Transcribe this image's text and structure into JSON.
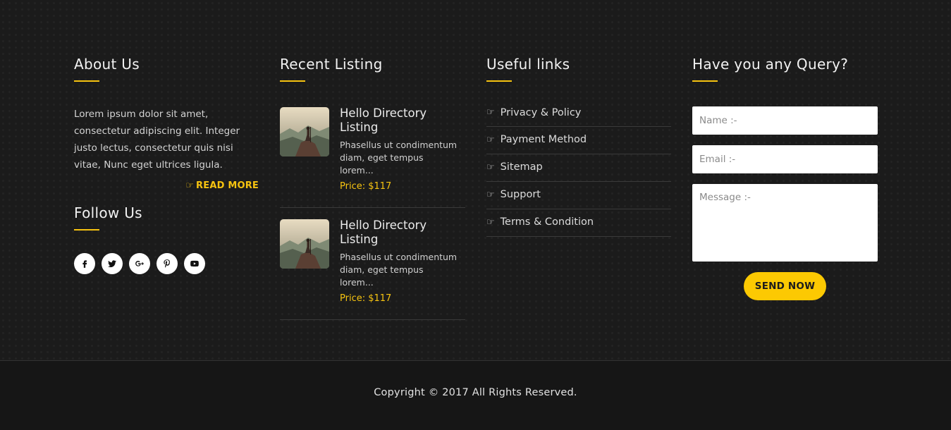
{
  "about": {
    "heading": "About Us",
    "text": "Lorem ipsum dolor sit amet, consectetur adipiscing elit. Integer justo lectus, consectetur quis nisi vitae, Nunc eget ultrices ligula.",
    "read_more": "READ MORE",
    "read_more_icon": "☞"
  },
  "follow": {
    "heading": "Follow Us",
    "icons": [
      "facebook-icon",
      "twitter-icon",
      "google-plus-icon",
      "pinterest-icon",
      "youtube-icon"
    ]
  },
  "recent": {
    "heading": "Recent Listing",
    "items": [
      {
        "title": "Hello Directory Listing",
        "desc": "Phasellus ut condimentum diam, eget tempus lorem...",
        "price": "Price: $117"
      },
      {
        "title": "Hello Directory Listing",
        "desc": "Phasellus ut condimentum diam, eget tempus lorem...",
        "price": "Price: $117"
      }
    ]
  },
  "links": {
    "heading": "Useful links",
    "icon": "☞",
    "items": [
      "Privacy & Policy",
      "Payment Method",
      "Sitemap",
      "Support",
      "Terms & Condition"
    ]
  },
  "query": {
    "heading": "Have you any Query?",
    "name_placeholder": "Name :-",
    "email_placeholder": "Email :-",
    "message_placeholder": "Message :-",
    "send_label": "SEND NOW"
  },
  "copyright": "Copyright © 2017 All Rights Reserved.",
  "colors": {
    "accent": "#f6c310",
    "button": "#fcc902",
    "background": "#1b1b1b"
  }
}
